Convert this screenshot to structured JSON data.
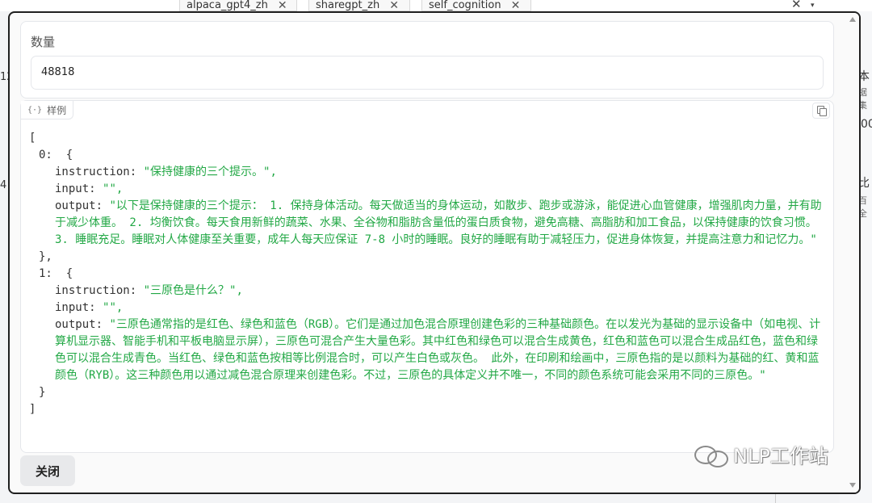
{
  "background": {
    "tabs": [
      {
        "label": "alpaca_gpt4_zh",
        "close": "✕"
      },
      {
        "label": "sharegpt_zh",
        "close": "✕"
      },
      {
        "label": "self_cognition",
        "close": "✕"
      }
    ],
    "clear_icon": "✕",
    "dropdown_icon": "▾",
    "left_fragments": [
      "12",
      "4"
    ],
    "right_fragments": [
      "本",
      "据集",
      "00",
      "比",
      "百全"
    ]
  },
  "modal": {
    "count": {
      "label": "数量",
      "value": "48818"
    },
    "json_viewer": {
      "tab_label": "样例",
      "tab_icon": "{·}",
      "copy_icon": "copy-icon",
      "open_bracket": "[",
      "close_bracket": "]",
      "items": [
        {
          "index": "0:",
          "open": "{",
          "close": "},",
          "fields": [
            {
              "key": "instruction:",
              "value": "\"保持健康的三个提示。\","
            },
            {
              "key": "input:",
              "value": "\"\","
            },
            {
              "key": "output:",
              "value": "\"以下是保持健康的三个提示： 1. 保持身体活动。每天做适当的身体运动，如散步、跑步或游泳，能促进心血管健康，增强肌肉力量，并有助于减少体重。 2. 均衡饮食。每天食用新鲜的蔬菜、水果、全谷物和脂肪含量低的蛋白质食物，避免高糖、高脂肪和加工食品，以保持健康的饮食习惯。 3. 睡眠充足。睡眠对人体健康至关重要，成年人每天应保证 7-8 小时的睡眠。良好的睡眠有助于减轻压力，促进身体恢复，并提高注意力和记忆力。\""
            }
          ]
        },
        {
          "index": "1:",
          "open": "{",
          "close": "}",
          "fields": [
            {
              "key": "instruction:",
              "value": "\"三原色是什么？\","
            },
            {
              "key": "input:",
              "value": "\"\","
            },
            {
              "key": "output:",
              "value": "\"三原色通常指的是红色、绿色和蓝色（RGB）。它们是通过加色混合原理创建色彩的三种基础颜色。在以发光为基础的显示设备中（如电视、计算机显示器、智能手机和平板电脑显示屏），三原色可混合产生大量色彩。其中红色和绿色可以混合生成黄色，红色和蓝色可以混合生成品红色，蓝色和绿色可以混合生成青色。当红色、绿色和蓝色按相等比例混合时，可以产生白色或灰色。 此外，在印刷和绘画中，三原色指的是以颜料为基础的红、黄和蓝颜色（RYB）。这三种颜色用以通过减色混合原理来创建色彩。不过，三原色的具体定义并不唯一，不同的颜色系统可能会采用不同的三原色。\""
            }
          ]
        }
      ]
    },
    "close_button": "关闭"
  },
  "watermark": "NLP工作站",
  "colors": {
    "string": "#22a845",
    "modal_border": "#1f1f1f",
    "button_bg": "#e8e9eb"
  }
}
